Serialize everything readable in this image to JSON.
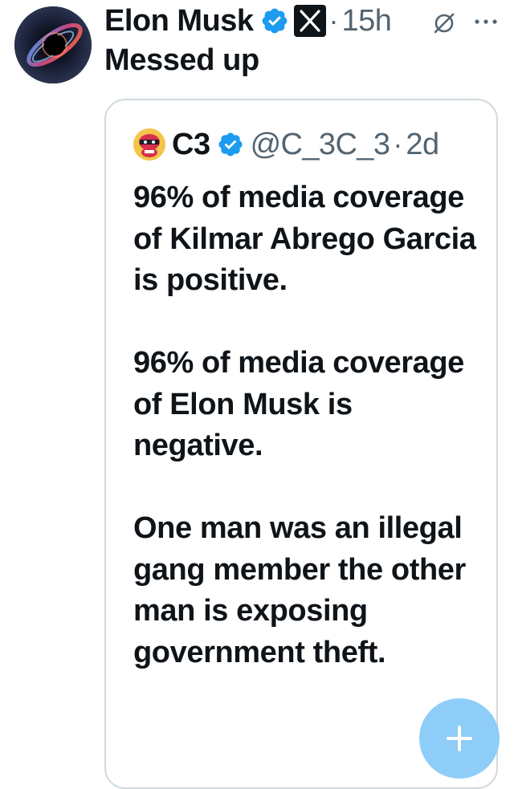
{
  "tweet": {
    "author_name": "Elon Musk",
    "time": "15h",
    "separator": "·",
    "text": "Messed up"
  },
  "quote": {
    "name": "C3",
    "handle": "@C_3C_3",
    "separator": "·",
    "time": "2d",
    "paragraphs": [
      "96% of media coverage of Kilmar Abrego Garcia is positive.",
      "96% of media coverage of Elon Musk is negative.",
      "One man was an illegal gang member the other man is exposing government theft."
    ]
  },
  "icons": {
    "verified": "verified-badge-icon",
    "affiliate": "x-logo-icon",
    "grok": "grok-icon",
    "more": "more-options-icon",
    "compose": "plus-icon"
  },
  "colors": {
    "verified_blue": "#1d9bf0",
    "secondary_text": "#536471",
    "fab": "#8ecdf7",
    "border": "#cfd9de"
  }
}
